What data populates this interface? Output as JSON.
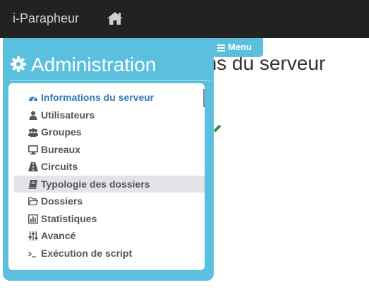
{
  "navbar": {
    "brand": "i-Parapheur",
    "home_icon": "home-icon"
  },
  "background": {
    "title_fragment": "ons du serveur"
  },
  "menu_tab": {
    "label": "Menu",
    "icon": "bars-icon"
  },
  "panel": {
    "title": "Administration",
    "icon": "gear-icon",
    "items": [
      {
        "label": "Informations du serveur",
        "icon": "dashboard-icon",
        "active": true
      },
      {
        "label": "Utilisateurs",
        "icon": "user-icon"
      },
      {
        "label": "Groupes",
        "icon": "users-icon"
      },
      {
        "label": "Bureaux",
        "icon": "desktop-icon"
      },
      {
        "label": "Circuits",
        "icon": "road-icon"
      },
      {
        "label": "Typologie des dossiers",
        "icon": "book-icon",
        "hover": true
      },
      {
        "label": "Dossiers",
        "icon": "folder-open-icon"
      },
      {
        "label": "Statistiques",
        "icon": "bar-chart-icon"
      },
      {
        "label": "Avancé",
        "icon": "sliders-icon"
      },
      {
        "label": "Exécution de script",
        "icon": "terminal-icon"
      }
    ]
  },
  "colors": {
    "navbar": "#222222",
    "panel": "#5bc0de",
    "active": "#337ab7",
    "hover": "#e5e3e8",
    "success": "#2e8b3a"
  }
}
